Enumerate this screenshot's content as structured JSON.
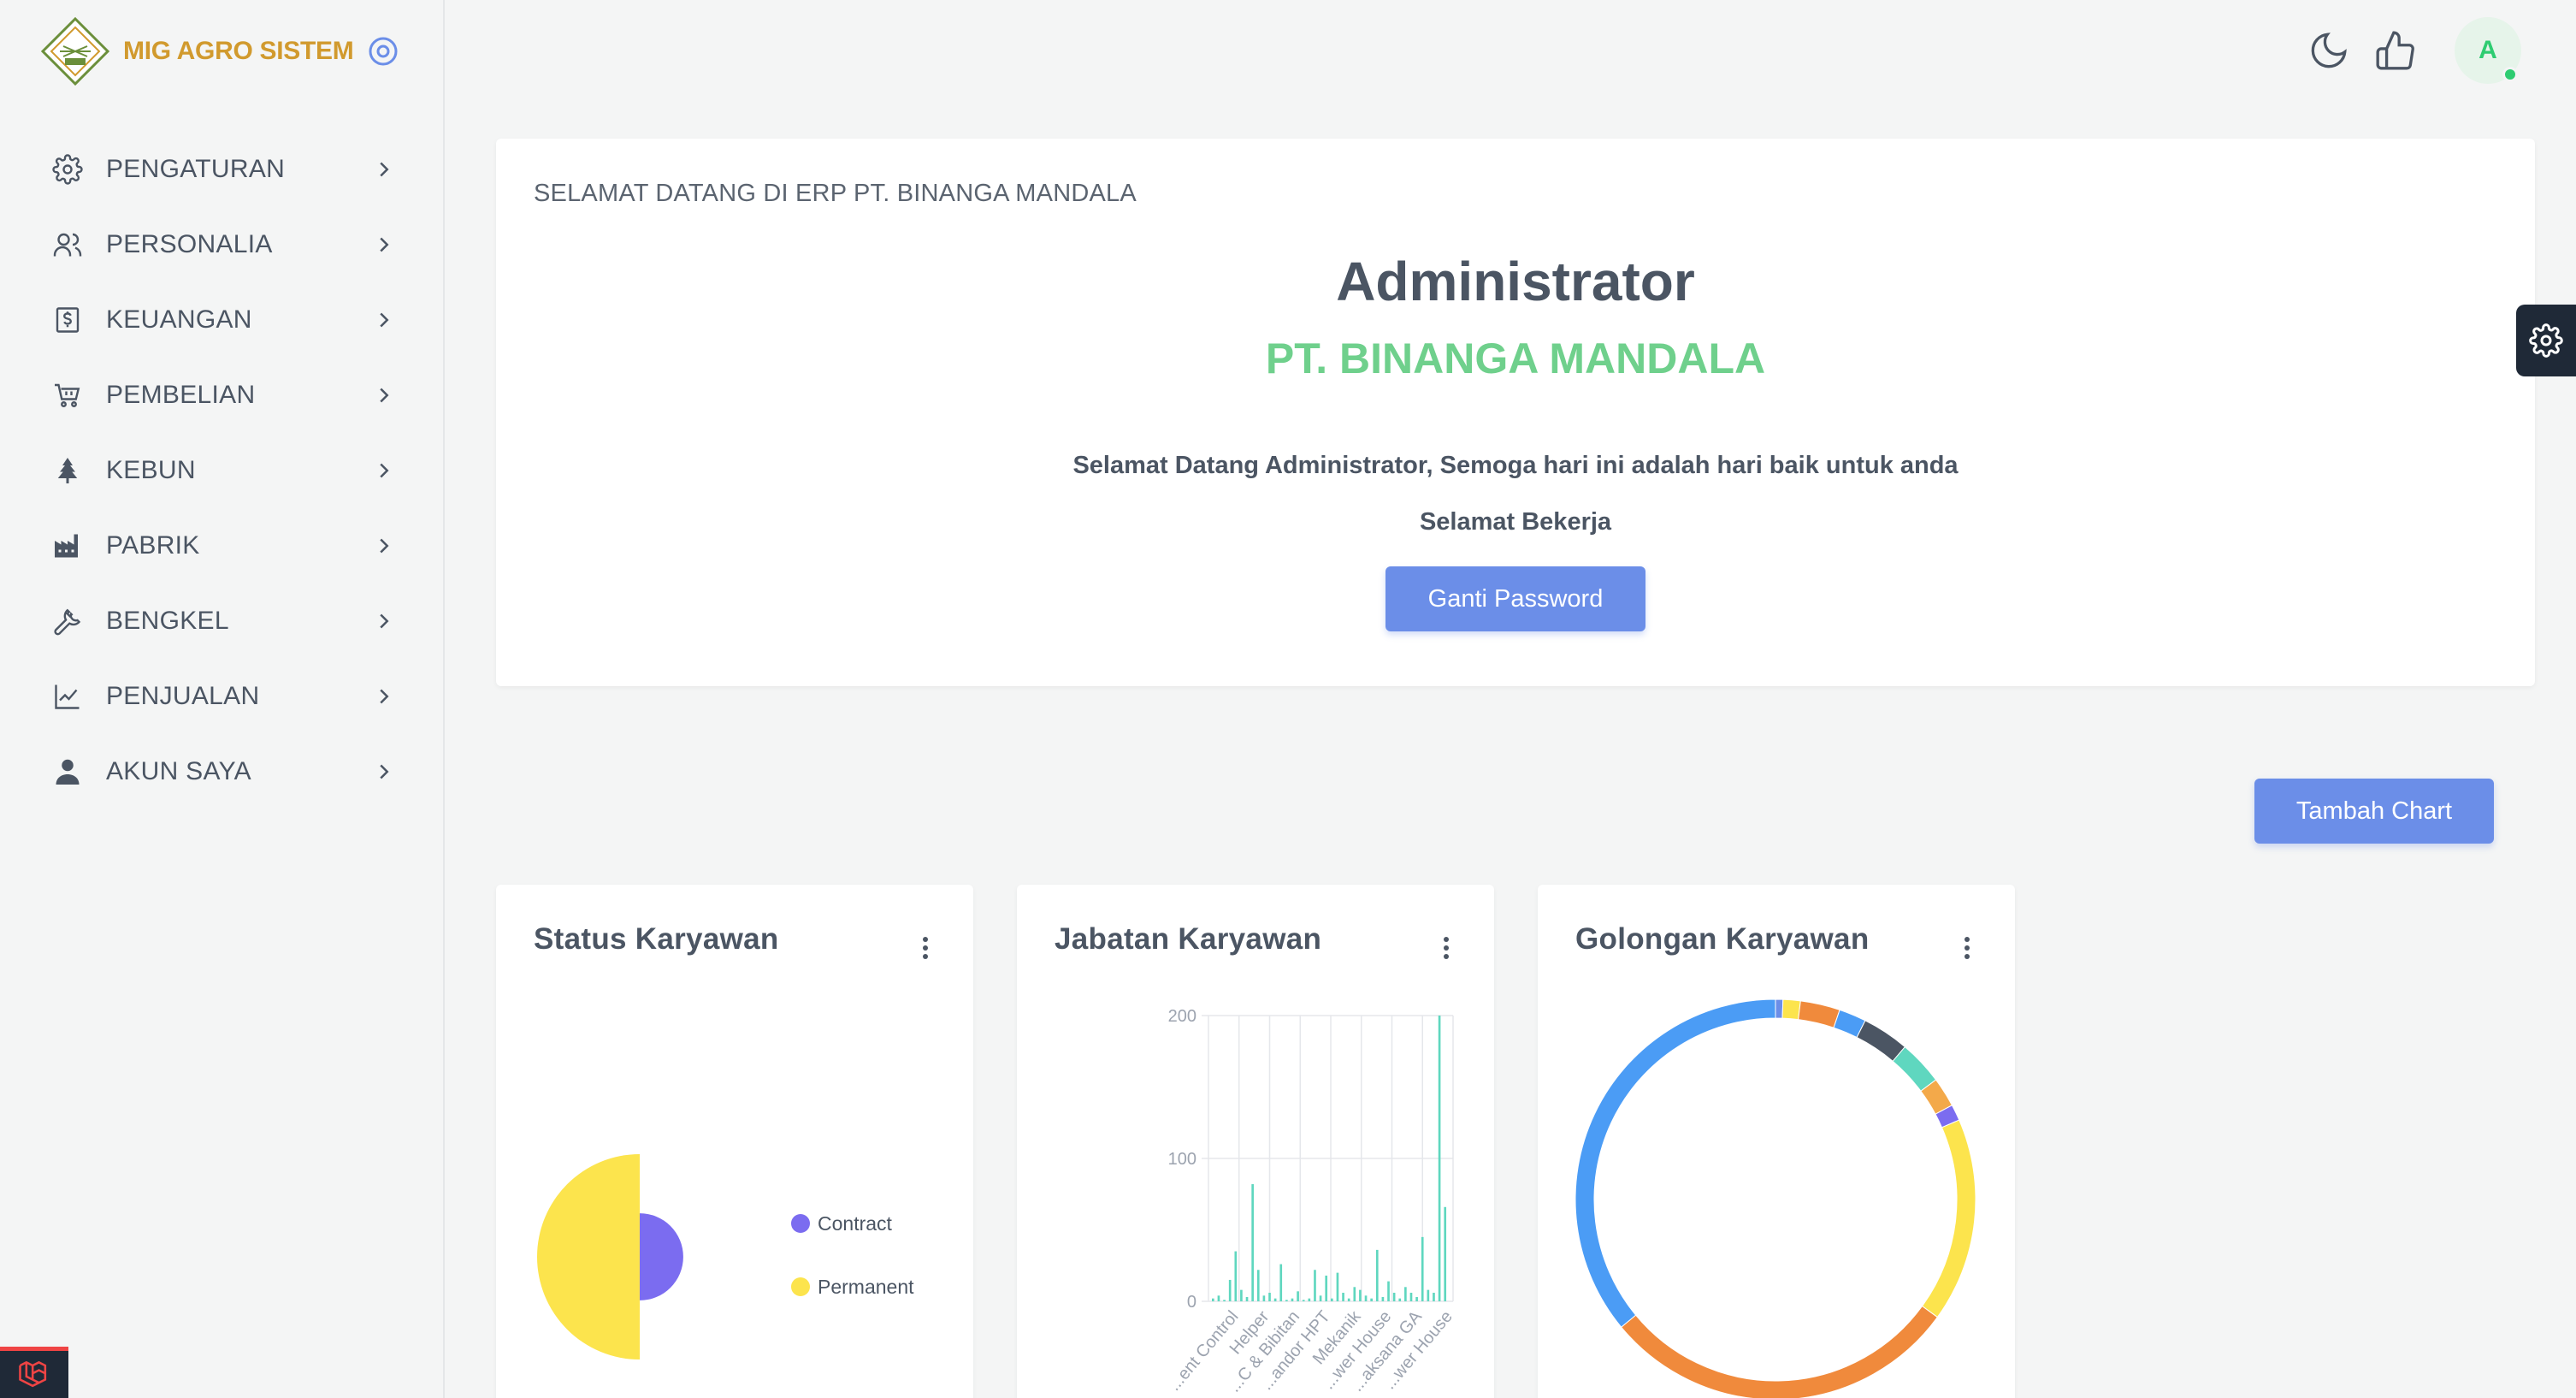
{
  "sidebar": {
    "brand": "MIG AGRO SISTEM",
    "items": [
      {
        "label": "PENGATURAN",
        "icon": "gear-icon"
      },
      {
        "label": "PERSONALIA",
        "icon": "users-icon"
      },
      {
        "label": "KEUANGAN",
        "icon": "dollar-file-icon"
      },
      {
        "label": "PEMBELIAN",
        "icon": "cart-icon"
      },
      {
        "label": "KEBUN",
        "icon": "tree-icon"
      },
      {
        "label": "PABRIK",
        "icon": "factory-icon"
      },
      {
        "label": "BENGKEL",
        "icon": "wrench-icon"
      },
      {
        "label": "PENJUALAN",
        "icon": "chart-line-icon"
      },
      {
        "label": "AKUN SAYA",
        "icon": "user-icon"
      }
    ]
  },
  "topbar": {
    "avatar_initial": "A"
  },
  "welcome": {
    "heading": "SELAMAT DATANG DI ERP PT. BINANGA MANDALA",
    "name": "Administrator",
    "company": "PT. BINANGA MANDALA",
    "message": "Selamat Datang Administrator, Semoga hari ini adalah hari baik untuk anda",
    "message2": "Selamat Bekerja",
    "button": "Ganti Password"
  },
  "actions": {
    "add_chart": "Tambah Chart"
  },
  "colors": {
    "primary": "#6b8ee8",
    "success": "#6fd08c",
    "brand": "#d19a2e"
  },
  "chart_data": [
    {
      "type": "pie",
      "title": "Status Karyawan",
      "series": [
        {
          "name": "Contract",
          "value": 18,
          "color": "#7b6cf0"
        },
        {
          "name": "Permanent",
          "value": 100,
          "color": "#fce44d"
        }
      ],
      "legend_position": "right"
    },
    {
      "type": "bar",
      "title": "Jabatan Karyawan",
      "ylim": [
        0,
        200
      ],
      "yticks": [
        0,
        100,
        200
      ],
      "categories": [
        "...ent Control",
        "Helper",
        "...C & Bibitan",
        "...andor HPT",
        "Mekanik",
        "...wer House",
        "...aksana GA",
        "...wer House"
      ],
      "values": [
        2,
        4,
        1,
        15,
        35,
        8,
        3,
        82,
        22,
        4,
        6,
        2,
        26,
        1,
        2,
        7,
        1,
        2,
        22,
        4,
        18,
        2,
        20,
        6,
        2,
        10,
        8,
        4,
        2,
        36,
        3,
        14,
        6,
        2,
        10,
        6,
        3,
        45,
        8,
        6,
        200,
        66
      ],
      "color": "#5fd7bf"
    },
    {
      "type": "doughnut",
      "title": "Golongan Karyawan",
      "series": [
        {
          "value": 0.6,
          "color": "#6b8ee8"
        },
        {
          "value": 1.4,
          "color": "#fce44d"
        },
        {
          "value": 3.2,
          "color": "#f08a3c"
        },
        {
          "value": 2.2,
          "color": "#4b9cf5"
        },
        {
          "value": 3.8,
          "color": "#4b5563"
        },
        {
          "value": 3.6,
          "color": "#5fd7bf"
        },
        {
          "value": 2.4,
          "color": "#f3a94a"
        },
        {
          "value": 1.3,
          "color": "#7b6cf0"
        },
        {
          "value": 16.5,
          "color": "#fce44d"
        },
        {
          "value": 29,
          "color": "#f08a3c"
        },
        {
          "value": 36,
          "color": "#4b9cf5"
        }
      ]
    }
  ]
}
